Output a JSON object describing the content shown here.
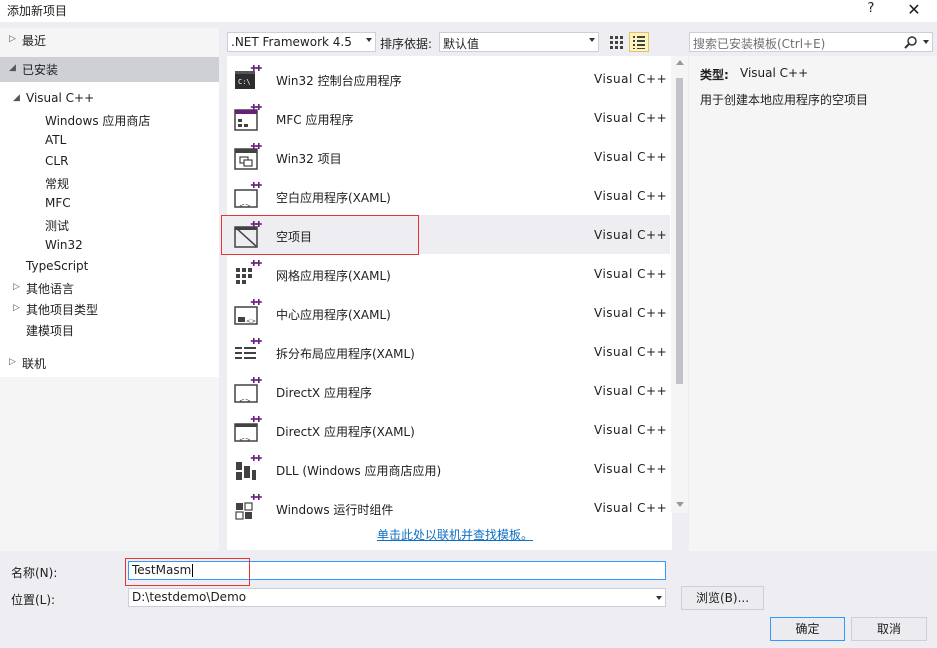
{
  "window": {
    "title": "添加新项目",
    "help": "?",
    "close": "✕"
  },
  "tree": {
    "recent": "最近",
    "installed": "已安装",
    "online": "联机",
    "nodes": [
      {
        "label": "Visual C++",
        "level": 1,
        "expanded": true
      },
      {
        "label": "Windows 应用商店",
        "level": 2
      },
      {
        "label": "ATL",
        "level": 2
      },
      {
        "label": "CLR",
        "level": 2
      },
      {
        "label": "常规",
        "level": 2
      },
      {
        "label": "MFC",
        "level": 2
      },
      {
        "label": "测试",
        "level": 2
      },
      {
        "label": "Win32",
        "level": 2
      },
      {
        "label": "TypeScript",
        "level": 1
      },
      {
        "label": "其他语言",
        "level": 1,
        "collapsed": true
      },
      {
        "label": "其他项目类型",
        "level": 1,
        "collapsed": true
      },
      {
        "label": "建模项目",
        "level": 1
      }
    ]
  },
  "toolbar": {
    "framework": ".NET Framework 4.5",
    "sort_label": "排序依据:",
    "sort_value": "默认值"
  },
  "templates": [
    {
      "name": "Win32 控制台应用程序",
      "lang": "Visual C++",
      "icon": "console-icon"
    },
    {
      "name": "MFC 应用程序",
      "lang": "Visual C++",
      "icon": "mfc-icon"
    },
    {
      "name": "Win32 项目",
      "lang": "Visual C++",
      "icon": "win32-project-icon"
    },
    {
      "name": "空白应用程序(XAML)",
      "lang": "Visual C++",
      "icon": "blank-app-icon"
    },
    {
      "name": "空项目",
      "lang": "Visual C++",
      "icon": "empty-project-icon"
    },
    {
      "name": "网格应用程序(XAML)",
      "lang": "Visual C++",
      "icon": "grid-app-icon"
    },
    {
      "name": "中心应用程序(XAML)",
      "lang": "Visual C++",
      "icon": "hub-app-icon"
    },
    {
      "name": "拆分布局应用程序(XAML)",
      "lang": "Visual C++",
      "icon": "split-app-icon"
    },
    {
      "name": "DirectX 应用程序",
      "lang": "Visual C++",
      "icon": "directx-app-icon"
    },
    {
      "name": "DirectX 应用程序(XAML)",
      "lang": "Visual C++",
      "icon": "directx-xaml-icon"
    },
    {
      "name": "DLL (Windows 应用商店应用)",
      "lang": "Visual C++",
      "icon": "dll-icon"
    },
    {
      "name": "Windows 运行时组件",
      "lang": "Visual C++",
      "icon": "runtime-component-icon"
    }
  ],
  "selected_template": 4,
  "online_link": "单击此处以联机并查找模板。",
  "search": {
    "placeholder": "搜索已安装模板(Ctrl+E)"
  },
  "info": {
    "type_label": "类型:",
    "type_value": "Visual C++",
    "description": "用于创建本地应用程序的空项目"
  },
  "form": {
    "name_label": "名称(N):",
    "name_value": "TestMasm",
    "location_label": "位置(L):",
    "location_value": "D:\\testdemo\\Demo",
    "browse": "浏览(B)...",
    "ok": "确定",
    "cancel": "取消"
  },
  "colors": {
    "accent": "#3399ff",
    "highlight_box": "#e63434",
    "selection": "#cfd0d6",
    "link": "#0e70c0"
  }
}
